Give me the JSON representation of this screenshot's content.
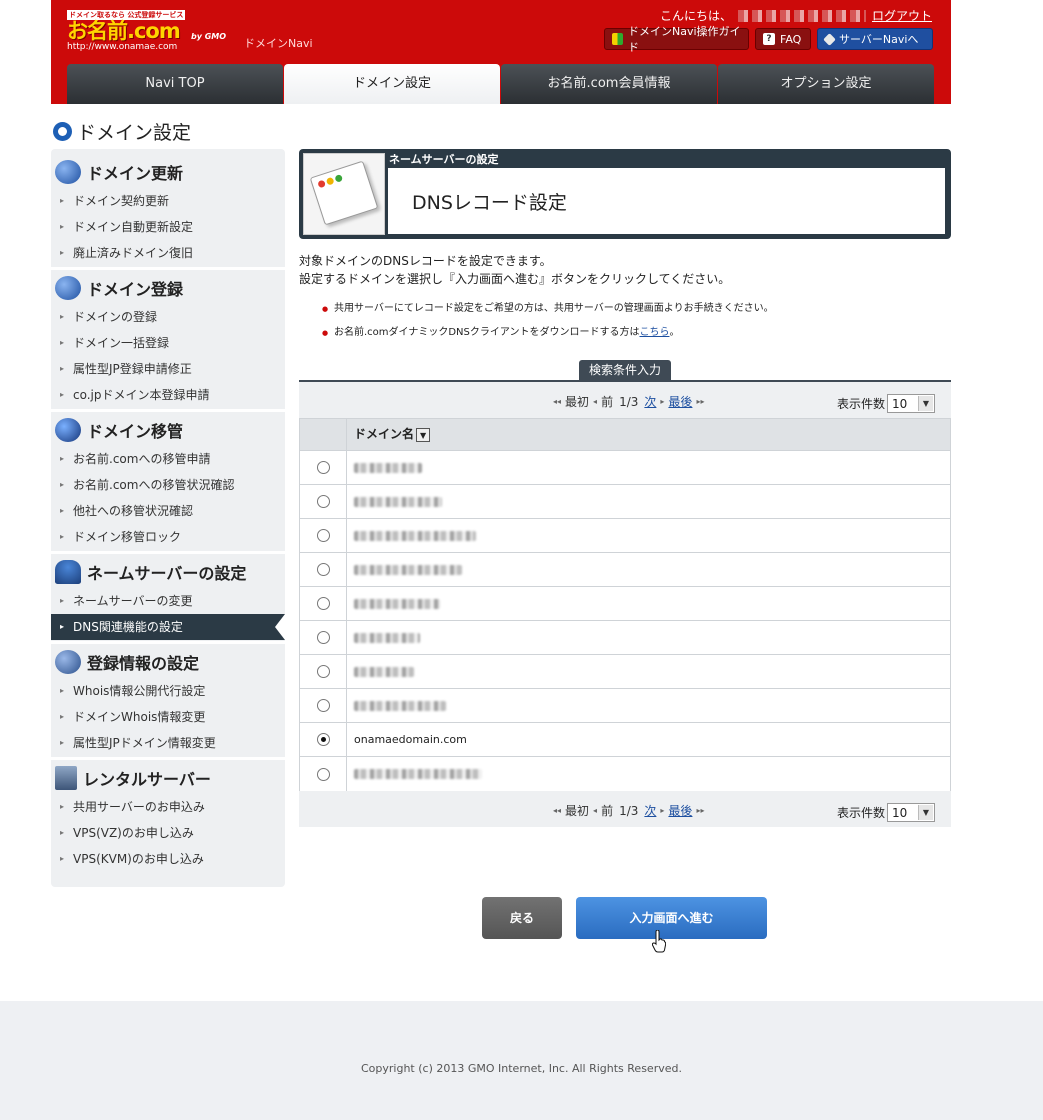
{
  "header": {
    "logo_tag": "ドメイン取るなら 公式登録サービス",
    "logo_main": "お名前.com",
    "logo_url": "http://www.onamae.com",
    "logo_gmo": "by GMO",
    "navi_label": "ドメインNavi",
    "greeting_prefix": "こんにちは、",
    "logout": "ログアウト",
    "guide_button": "ドメインNavi操作ガイド",
    "faq_button": "FAQ",
    "server_button": "サーバーNaviへ"
  },
  "tabs": [
    {
      "label": "Navi TOP"
    },
    {
      "label": "ドメイン設定"
    },
    {
      "label": "お名前.com会員情報"
    },
    {
      "label": "オプション設定"
    }
  ],
  "page_title": "ドメイン設定",
  "sidebar": {
    "sections": [
      {
        "title": "ドメイン更新",
        "icon": "renew-icon",
        "items": [
          "ドメイン契約更新",
          "ドメイン自動更新設定",
          "廃止済みドメイン復旧"
        ]
      },
      {
        "title": "ドメイン登録",
        "icon": "plus-icon",
        "items": [
          "ドメインの登録",
          "ドメイン一括登録",
          "属性型JP登録申請修正",
          "co.jpドメイン本登録申請"
        ]
      },
      {
        "title": "ドメイン移管",
        "icon": "transfer-icon",
        "items": [
          "お名前.comへの移管申請",
          "お名前.comへの移管状況確認",
          "他社への移管状況確認",
          "ドメイン移管ロック"
        ]
      },
      {
        "title": "ネームサーバーの設定",
        "icon": "nameserver-icon",
        "items": [
          "ネームサーバーの変更",
          "DNS関連機能の設定"
        ]
      },
      {
        "title": "登録情報の設定",
        "icon": "info-icon",
        "items": [
          "Whois情報公開代行設定",
          "ドメインWhois情報変更",
          "属性型JPドメイン情報変更"
        ]
      },
      {
        "title": "レンタルサーバー",
        "icon": "server-icon",
        "items": [
          "共用サーバーのお申込み",
          "VPS(VZ)のお申し込み",
          "VPS(KVM)のお申し込み"
        ]
      }
    ],
    "active_item": "DNS関連機能の設定"
  },
  "banner": {
    "subtitle": "ネームサーバーの設定",
    "title": "DNSレコード設定"
  },
  "description": {
    "line1": "対象ドメインのDNSレコードを設定できます。",
    "line2": "設定するドメインを選択し『入力画面へ進む』ボタンをクリックしてください。"
  },
  "notes": {
    "note1": "共用サーバーにてレコード設定をご希望の方は、共用サーバーの管理画面よりお手続きください。",
    "note2_prefix": "お名前.comダイナミックDNSクライアントをダウンロードする方は",
    "note2_link": "こちら",
    "note2_suffix": "。"
  },
  "search_tab": "検索条件入力",
  "pager": {
    "first": "最初",
    "prev": "前",
    "page": "1/3",
    "next": "次",
    "last": "最後",
    "per_page_label": "表示件数",
    "per_page_value": "10"
  },
  "table": {
    "header": "ドメイン名",
    "rows": [
      {
        "domain": "",
        "selected": false
      },
      {
        "domain": "",
        "selected": false
      },
      {
        "domain": "",
        "selected": false
      },
      {
        "domain": "",
        "selected": false
      },
      {
        "domain": "",
        "selected": false
      },
      {
        "domain": "",
        "selected": false
      },
      {
        "domain": "",
        "selected": false
      },
      {
        "domain": "",
        "selected": false
      },
      {
        "domain": "onamaedomain.com",
        "selected": true
      },
      {
        "domain": "",
        "selected": false
      }
    ]
  },
  "buttons": {
    "back": "戻る",
    "next": "入力画面へ進む"
  },
  "footer": {
    "copyright": "Copyright (c) 2013 GMO Internet, Inc. All Rights Reserved."
  },
  "colors": {
    "header_red": "#cc0a0a",
    "nav_dark": "#2b3a45",
    "accent_blue": "#1d5fb5",
    "button_blue": "#2a6cc0"
  }
}
